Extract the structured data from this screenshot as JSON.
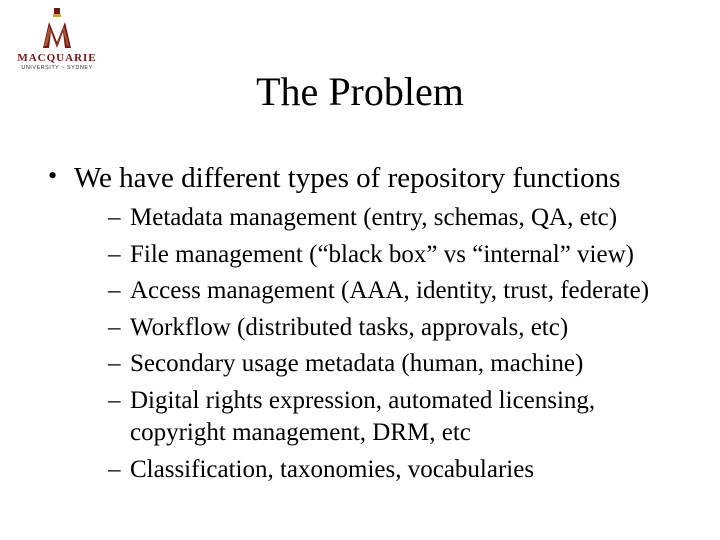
{
  "logo": {
    "name": "MACQUARIE",
    "sub": "UNIVERSITY ~ SYDNEY"
  },
  "title": "The Problem",
  "bullet": {
    "text": "We have different types of repository functions",
    "subitems": [
      "Metadata management (entry, schemas, QA, etc)",
      "File management (“black box” vs “internal” view)",
      "Access management (AAA, identity, trust, federate)",
      "Workflow (distributed tasks, approvals, etc)",
      "Secondary usage metadata (human, machine)",
      "Digital rights expression, automated licensing, copyright management, DRM, etc",
      "Classification, taxonomies, vocabularies"
    ]
  }
}
